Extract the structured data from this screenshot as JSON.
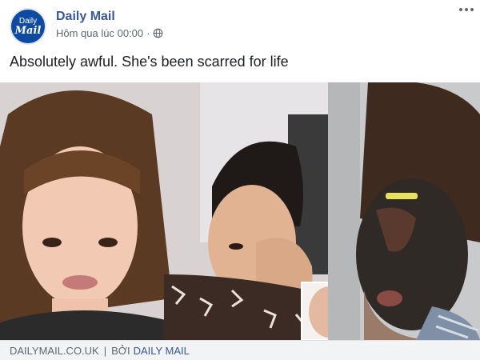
{
  "post": {
    "page": {
      "name": "Daily Mail",
      "avatar_line1": "Daily",
      "avatar_line2": "Mail"
    },
    "timestamp": "Hôm qua lúc 00:00",
    "separator": "·",
    "privacy_icon": "globe-icon",
    "more_icon": "more-options-icon",
    "message": "Absolutely awful. She's been scarred for life"
  },
  "link": {
    "domain": "DAILYMAIL.CO.UK",
    "separator": "|",
    "by_label": "BỞI",
    "author": "DAILY MAIL"
  },
  "colors": {
    "brand_link": "#385898",
    "meta_text": "#606770",
    "footer_bg": "#f2f3f5",
    "avatar_bg": "#0e4aa0"
  }
}
